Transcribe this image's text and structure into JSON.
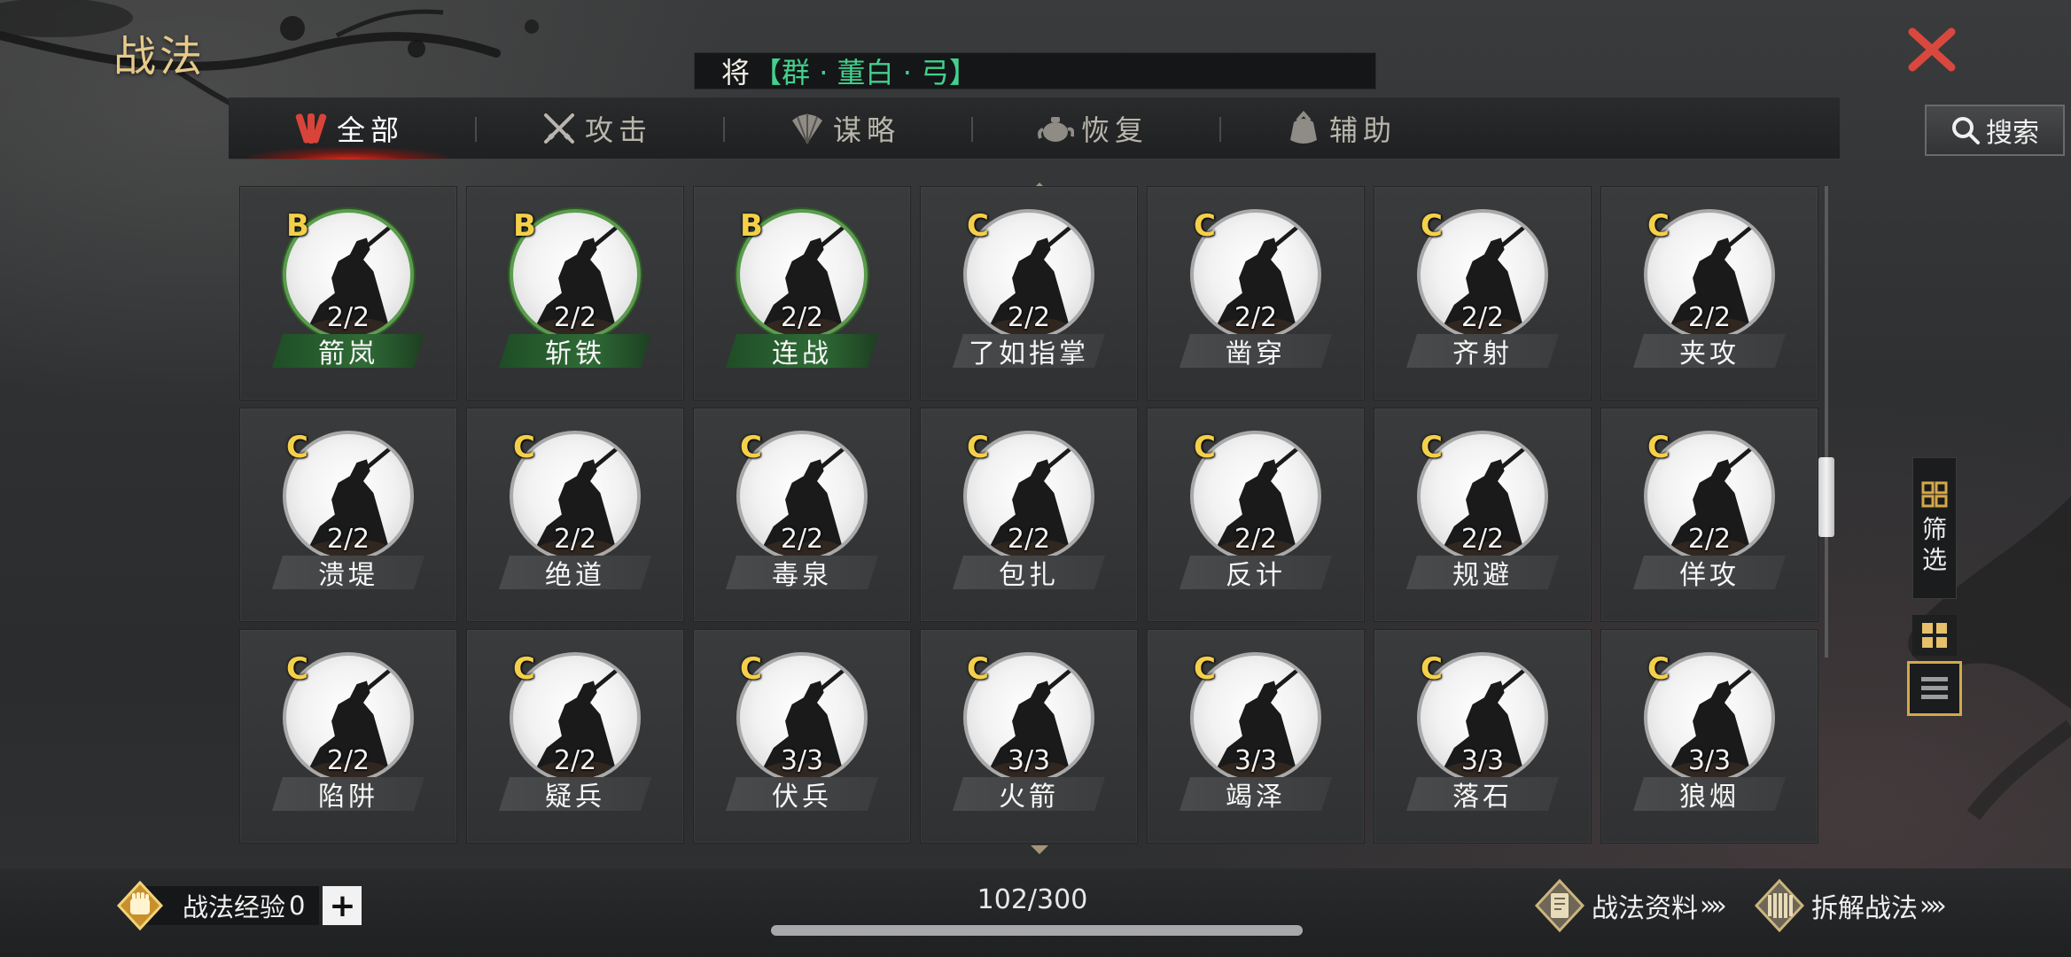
{
  "page_title": "战法",
  "general_banner": {
    "prefix": "将",
    "tag": "【群 · 董白 · 弓】"
  },
  "tabs": [
    {
      "label": "全部",
      "icon": "all-skills-icon",
      "active": true
    },
    {
      "label": "攻击",
      "icon": "crossed-swords-icon",
      "active": false
    },
    {
      "label": "谋略",
      "icon": "strategy-fan-icon",
      "active": false
    },
    {
      "label": "恢复",
      "icon": "recovery-teapot-icon",
      "active": false
    },
    {
      "label": "辅助",
      "icon": "support-pouch-icon",
      "active": false
    }
  ],
  "search": {
    "label": "搜索",
    "icon": "search-icon"
  },
  "skills": [
    {
      "grade": "B",
      "count": "2/2",
      "name": "箭岚"
    },
    {
      "grade": "B",
      "count": "2/2",
      "name": "斩铁"
    },
    {
      "grade": "B",
      "count": "2/2",
      "name": "连战"
    },
    {
      "grade": "C",
      "count": "2/2",
      "name": "了如指掌"
    },
    {
      "grade": "C",
      "count": "2/2",
      "name": "凿穿"
    },
    {
      "grade": "C",
      "count": "2/2",
      "name": "齐射"
    },
    {
      "grade": "C",
      "count": "2/2",
      "name": "夹攻"
    },
    {
      "grade": "C",
      "count": "2/2",
      "name": "溃堤"
    },
    {
      "grade": "C",
      "count": "2/2",
      "name": "绝道"
    },
    {
      "grade": "C",
      "count": "2/2",
      "name": "毒泉"
    },
    {
      "grade": "C",
      "count": "2/2",
      "name": "包扎"
    },
    {
      "grade": "C",
      "count": "2/2",
      "name": "反计"
    },
    {
      "grade": "C",
      "count": "2/2",
      "name": "规避"
    },
    {
      "grade": "C",
      "count": "2/2",
      "name": "佯攻"
    },
    {
      "grade": "C",
      "count": "2/2",
      "name": "陷阱"
    },
    {
      "grade": "C",
      "count": "2/2",
      "name": "疑兵"
    },
    {
      "grade": "C",
      "count": "3/3",
      "name": "伏兵"
    },
    {
      "grade": "C",
      "count": "3/3",
      "name": "火箭"
    },
    {
      "grade": "C",
      "count": "3/3",
      "name": "竭泽"
    },
    {
      "grade": "C",
      "count": "3/3",
      "name": "落石"
    },
    {
      "grade": "C",
      "count": "3/3",
      "name": "狼烟"
    }
  ],
  "side": {
    "filter_label": "筛选"
  },
  "bottom": {
    "exp_label": "战法经验",
    "exp_value": "0",
    "exp_plus": "+",
    "page_count": "102/300",
    "info_link": "战法资料",
    "dismantle_link": "拆解战法",
    "chevrons": "»»"
  },
  "colors": {
    "title_gold": "#e7c98a",
    "banner_green": "#43d08e",
    "grade_yellow": "#f4d04a",
    "b_grade_plate": "#2f6b36",
    "close_red": "#d8483e",
    "active_tab_glow": "#d22b1e"
  }
}
